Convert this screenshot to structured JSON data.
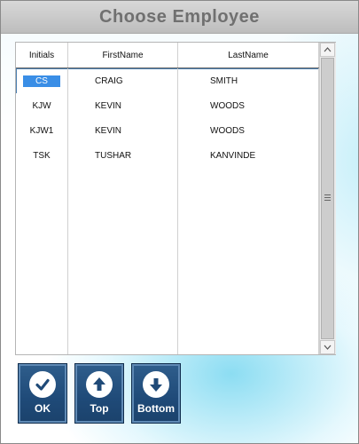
{
  "window": {
    "title": "Choose Employee"
  },
  "grid": {
    "columns": [
      "Initials",
      "FirstName",
      "LastName"
    ],
    "rows": [
      {
        "initials": "CS",
        "first": "CRAIG",
        "last": "SMITH",
        "selected": true
      },
      {
        "initials": "KJW",
        "first": "KEVIN",
        "last": "WOODS"
      },
      {
        "initials": "KJW1",
        "first": "KEVIN",
        "last": "WOODS"
      },
      {
        "initials": "TSK",
        "first": "TUSHAR",
        "last": "KANVINDE"
      }
    ]
  },
  "scrollbar": {
    "up_icon": "chevron-up-icon",
    "down_icon": "chevron-down-icon"
  },
  "buttons": {
    "ok": {
      "label": "OK",
      "icon": "check-icon"
    },
    "top": {
      "label": "Top",
      "icon": "arrow-up-icon"
    },
    "bottom": {
      "label": "Bottom",
      "icon": "arrow-down-icon"
    }
  },
  "colors": {
    "selection": "#3a8ee6",
    "button": "#1f4a78",
    "title": "#707070"
  }
}
